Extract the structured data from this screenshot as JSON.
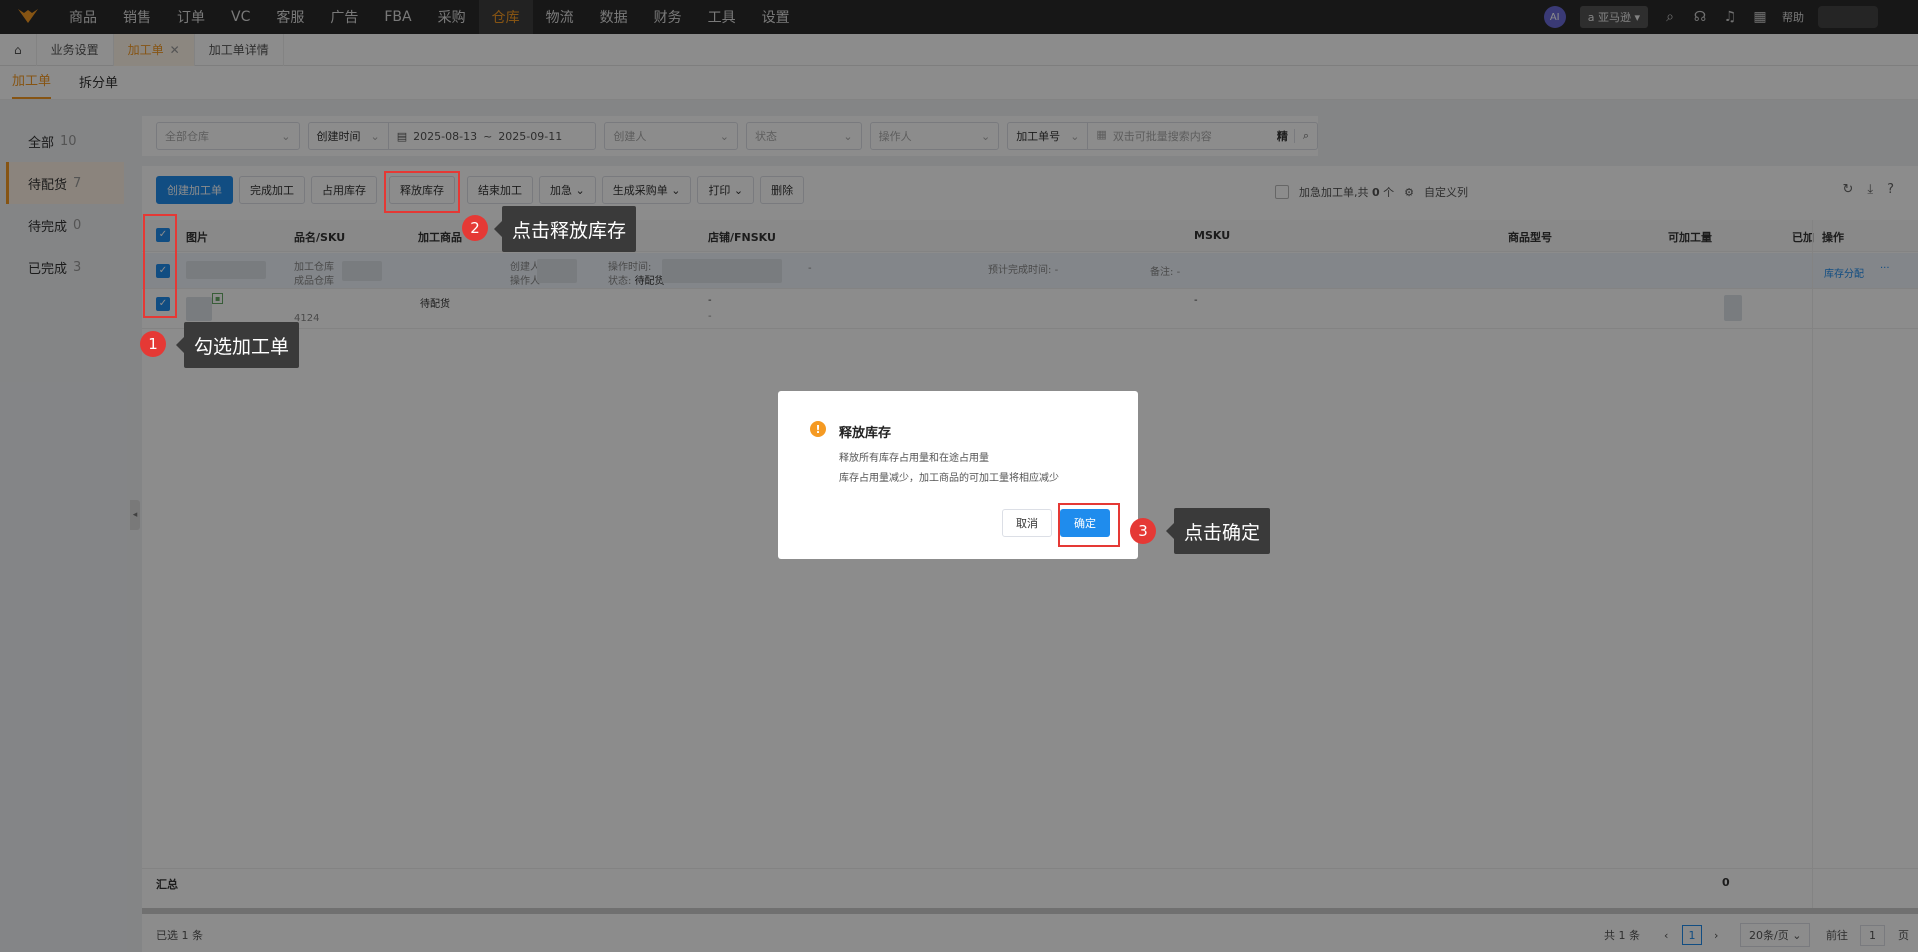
{
  "nav": {
    "items": [
      "商品",
      "销售",
      "订单",
      "VC",
      "客服",
      "广告",
      "FBA",
      "采购",
      "仓库",
      "物流",
      "数据",
      "财务",
      "工具",
      "设置"
    ],
    "active_index": 8,
    "ai_label": "AI",
    "marketplace": "亚马逊",
    "help": "帮助"
  },
  "tabs": {
    "business_settings": "业务设置",
    "processing_order": "加工单",
    "processing_detail": "加工单详情"
  },
  "subtabs": [
    "加工单",
    "拆分单"
  ],
  "sidebar": [
    {
      "label": "全部",
      "count": "10"
    },
    {
      "label": "待配货",
      "count": "7"
    },
    {
      "label": "待完成",
      "count": "0"
    },
    {
      "label": "已完成",
      "count": "3"
    }
  ],
  "filters": {
    "warehouse_placeholder": "全部仓库",
    "time_type": "创建时间",
    "date_start": "2025-08-13",
    "date_sep": "~",
    "date_end": "2025-09-11",
    "creator_placeholder": "创建人",
    "status_placeholder": "状态",
    "operator_placeholder": "操作人",
    "search_type": "加工单号",
    "search_placeholder": "双击可批量搜索内容",
    "precise": "精"
  },
  "buttons": [
    "创建加工单",
    "完成加工",
    "占用库存",
    "释放库存",
    "结束加工",
    "加急",
    "生成采购单",
    "打印",
    "删除"
  ],
  "toolbar_right": {
    "urgent_prefix": "加急加工单,共",
    "urgent_count": "0",
    "urgent_suffix": "个",
    "custom_columns": "自定义列"
  },
  "table": {
    "headers": [
      "图片",
      "品名/SKU",
      "加工商品",
      "店铺/FNSKU",
      "MSKU",
      "商品型号",
      "可加工量",
      "已加",
      "操作"
    ],
    "row1": {
      "warehouse": "加工仓库",
      "product_warehouse": "成品仓库",
      "creator": "创建人",
      "operator": "操作人",
      "op_time": "操作时间:",
      "status_label": "状态:",
      "status": "待配货",
      "dash": "-",
      "expected": "预计完成时间:",
      "expected_val": "-",
      "remark": "备注:",
      "remark_val": "-",
      "action": "库存分配",
      "more": "···"
    },
    "row2": {
      "sku": "4124",
      "status": "待配货",
      "shop": "-",
      "fnsku": "-",
      "msku": "-"
    },
    "summary_label": "汇总",
    "summary_value": "0"
  },
  "pager": {
    "selected_prefix": "已选",
    "selected_count": "1",
    "selected_suffix": "条",
    "total_prefix": "共",
    "total_count": "1",
    "total_suffix": "条",
    "page": "1",
    "page_size": "20条/页",
    "goto": "前往",
    "goto_page": "1",
    "page_unit": "页"
  },
  "dialog": {
    "title": "释放库存",
    "line1": "释放所有库存占用量和在途占用量",
    "line2": "库存占用量减少，加工商品的可加工量将相应减少",
    "cancel": "取消",
    "confirm": "确定"
  },
  "annotations": [
    {
      "num": "1",
      "text": "勾选加工单"
    },
    {
      "num": "2",
      "text": "点击释放库存"
    },
    {
      "num": "3",
      "text": "点击确定"
    }
  ]
}
